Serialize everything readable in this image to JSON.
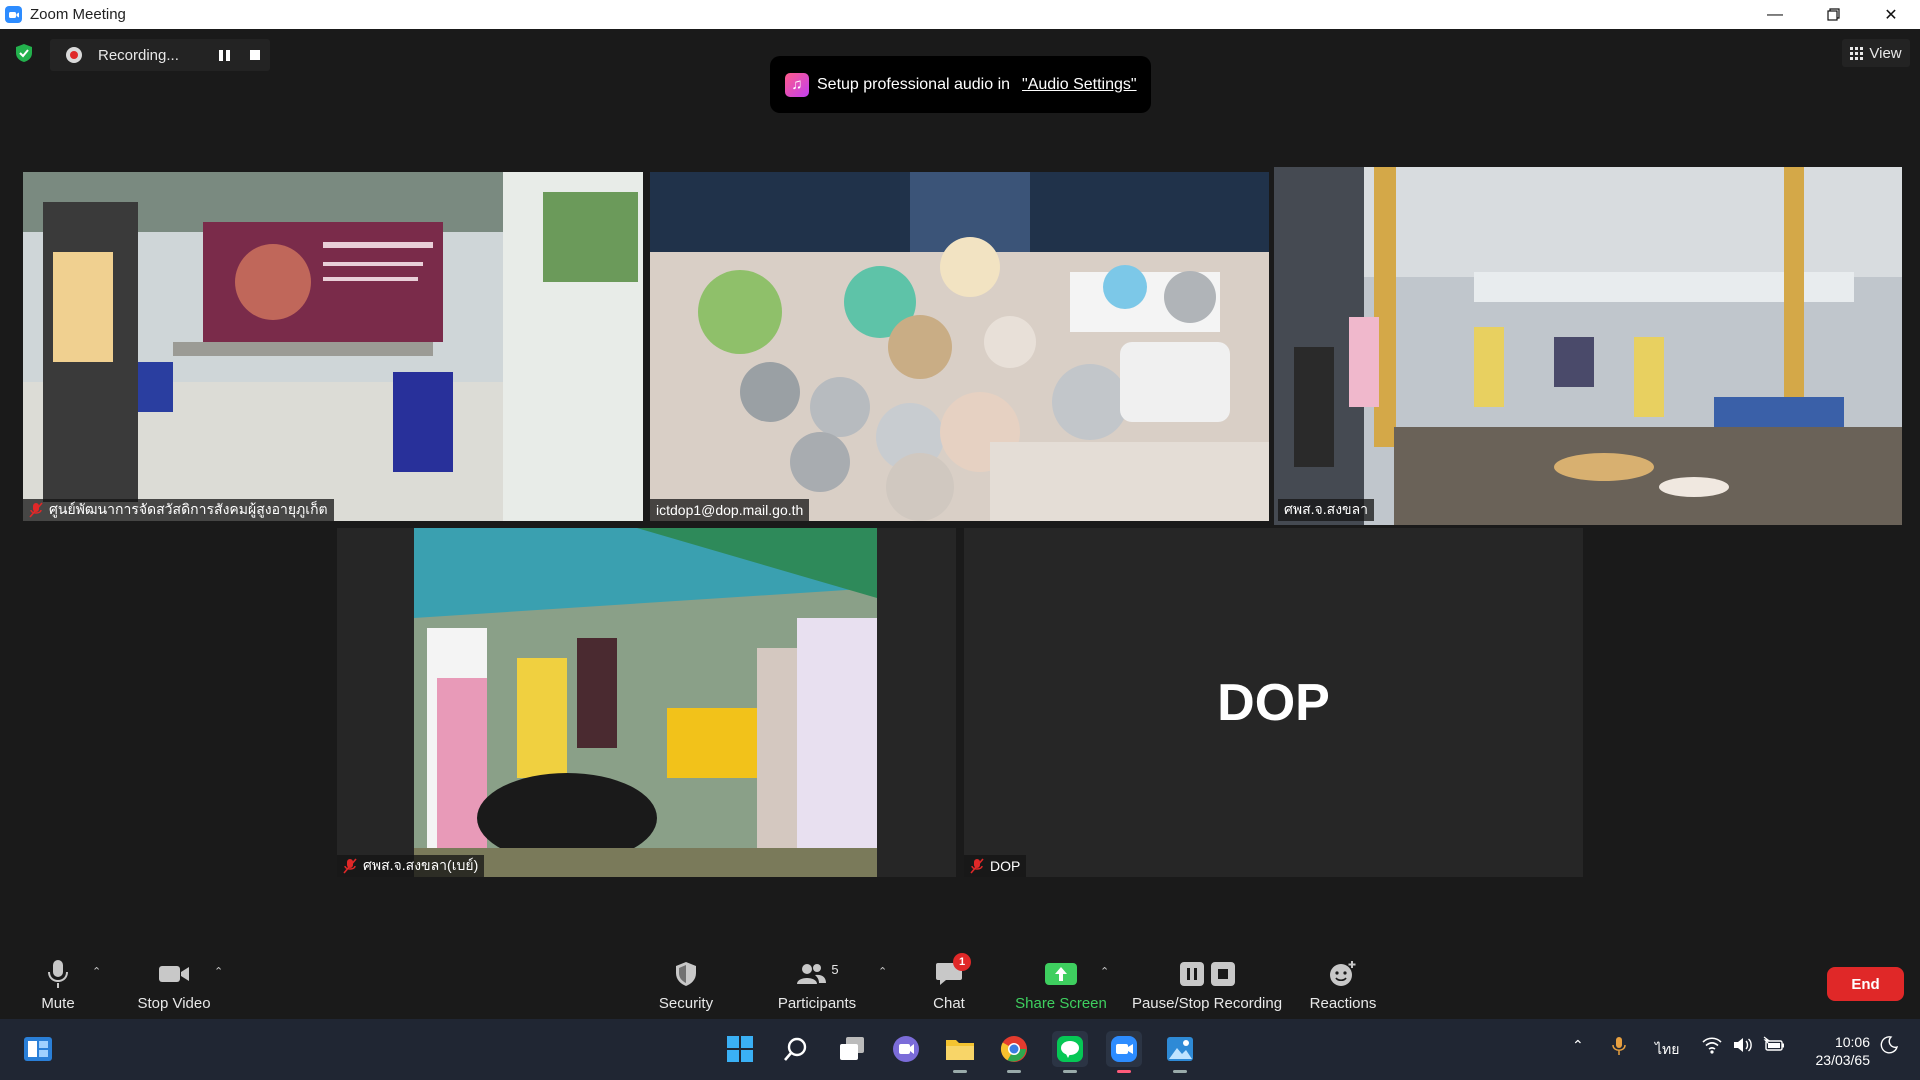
{
  "window": {
    "title": "Zoom Meeting"
  },
  "recording": {
    "label": "Recording..."
  },
  "view": {
    "label": "View"
  },
  "toast": {
    "text": "Setup professional audio in",
    "link": "\"Audio Settings\""
  },
  "tiles": [
    {
      "name": "ศูนย์พัฒนาการจัดสวัสดิการสังคมผู้สูงอายุภูเก็ต",
      "muted": true
    },
    {
      "name": "ictdop1@dop.mail.go.th",
      "muted": false
    },
    {
      "name": "ศพส.จ.สงขลา",
      "muted": false
    },
    {
      "name": "ศพส.จ.สงขลา(เบย์)",
      "muted": true
    },
    {
      "name": "DOP",
      "muted": true,
      "display": "DOP"
    }
  ],
  "toolbar": {
    "mute": "Mute",
    "stop_video": "Stop Video",
    "security": "Security",
    "participants": "Participants",
    "participant_count": "5",
    "chat": "Chat",
    "chat_badge": "1",
    "share_screen": "Share Screen",
    "pause_stop_recording": "Pause/Stop Recording",
    "reactions": "Reactions",
    "end": "End"
  },
  "taskbar": {
    "language": "ไทย",
    "time": "10:06",
    "date": "23/03/65"
  },
  "colors": {
    "active_speaker": "#e0e566",
    "share_green": "#3ecf5f",
    "end_red": "#e02828",
    "zoom_blue": "#2d8cff"
  }
}
